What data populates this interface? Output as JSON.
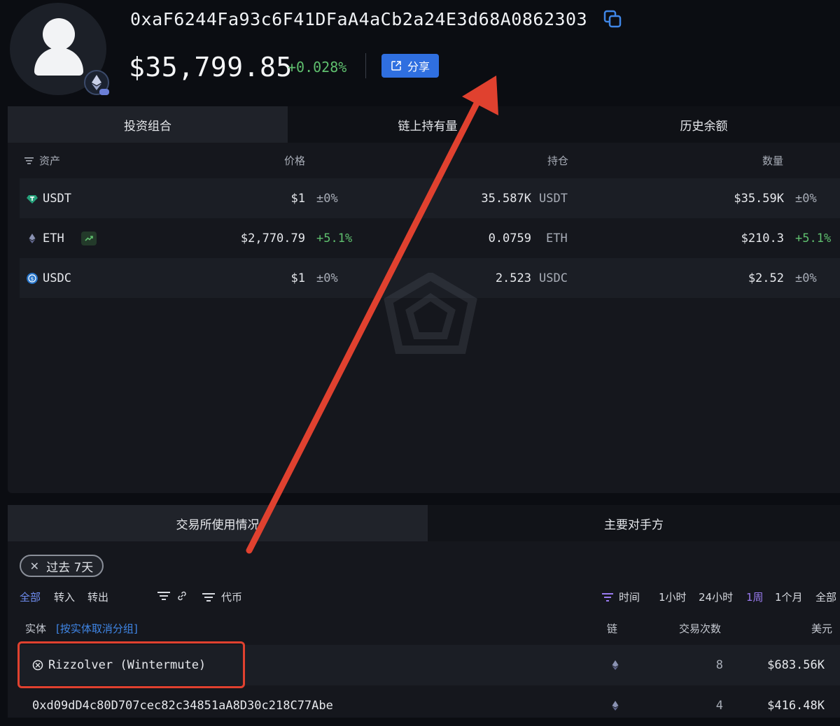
{
  "header": {
    "address": "0xaF6244Fa93c6F41DFaA4aCb2a24E3d68A0862303",
    "balance": "$35,799.85",
    "balance_change": "+0.028%",
    "share_label": "分享",
    "chain_icon": "ethereum-icon"
  },
  "portfolio": {
    "tabs": [
      "投资组合",
      "链上持有量",
      "历史余额"
    ],
    "columns": {
      "asset": "资产",
      "price": "价格",
      "holding": "持仓",
      "amount": "数量"
    },
    "rows": [
      {
        "symbol": "USDT",
        "icon": "tether-icon",
        "icon_color": "#26a17b",
        "price": "$1",
        "price_change": "±0%",
        "holding": "35.587K",
        "holding_unit": "USDT",
        "value": "$35.59K",
        "value_change": "±0%"
      },
      {
        "symbol": "ETH",
        "icon": "ethereum-icon",
        "icon_color": "#8a92b2",
        "price": "$2,770.79",
        "price_change": "+5.1%",
        "holding": "0.0759",
        "holding_unit": "ETH",
        "value": "$210.3",
        "value_change": "+5.1%"
      },
      {
        "symbol": "USDC",
        "icon": "usdc-icon",
        "icon_color": "#2775ca",
        "price": "$1",
        "price_change": "±0%",
        "holding": "2.523",
        "holding_unit": "USDC",
        "value": "$2.52",
        "value_change": "±0%"
      }
    ]
  },
  "counterparties": {
    "tabs": [
      "交易所使用情况",
      "主要对手方"
    ],
    "filter_chip": "过去 7天",
    "direction_filters": [
      "全部",
      "转入",
      "转出"
    ],
    "token_filter": "代币",
    "time_filter_label": "时间",
    "time_ranges": [
      "1小时",
      "24小时",
      "1周",
      "1个月",
      "全部"
    ],
    "active_time_range": "1周",
    "columns": {
      "entity": "实体",
      "ungroup": "[按实体取消分组]",
      "chain": "链",
      "tx_count": "交易次数",
      "usd": "美元"
    },
    "rows": [
      {
        "entity": "Rizzolver (Wintermute)",
        "chain": "ethereum-icon",
        "tx_count": "8",
        "usd": "$683.56K"
      },
      {
        "entity": "0xd09dD4c80D707cec82c34851aA8D30c218C77Abe",
        "chain": "ethereum-icon",
        "tx_count": "4",
        "usd": "$416.48K"
      }
    ]
  },
  "colors": {
    "accent": "#2f6fe0",
    "positive": "#5fbf6e",
    "annotation": "#e0412f",
    "active_filter": "#6f8df0"
  }
}
